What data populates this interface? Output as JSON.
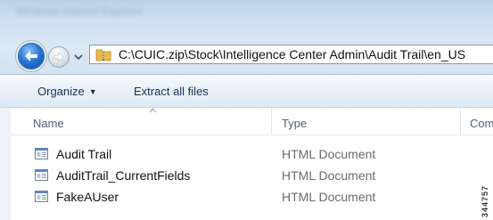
{
  "window": {
    "title": "Windows Internet Explorer"
  },
  "navigation": {
    "back_icon": "back-arrow-icon",
    "forward_icon": "forward-arrow-icon",
    "history_icon": "chevron-down-icon",
    "address_icon": "zip-folder-icon",
    "address_path": "C:\\CUIC.zip\\Stock\\Intelligence Center Admin\\Audit Trail\\en_US"
  },
  "toolbar": {
    "organize_label": "Organize",
    "extract_label": "Extract all files"
  },
  "columns": {
    "name": "Name",
    "type": "Type",
    "comp": "Comp"
  },
  "files": [
    {
      "name": "Audit Trail",
      "type": "HTML Document",
      "icon": "html-document-icon"
    },
    {
      "name": "AuditTrail_CurrentFields",
      "type": "HTML Document",
      "icon": "html-document-icon"
    },
    {
      "name": "FakeAUser",
      "type": "HTML Document",
      "icon": "html-document-icon"
    }
  ],
  "side_id": "344757",
  "colors": {
    "accent": "#2b78d6",
    "toolbar_text": "#1e3050",
    "type_text": "#6b6b6b"
  }
}
